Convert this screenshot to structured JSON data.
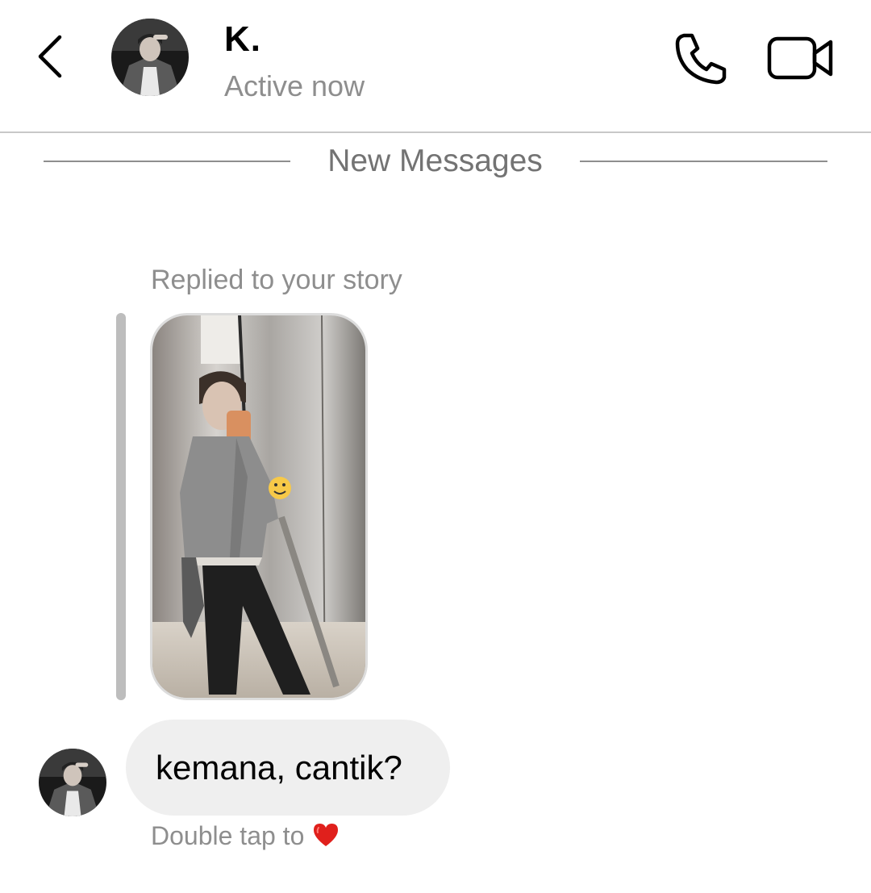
{
  "header": {
    "name": "K.",
    "status": "Active now",
    "back_icon": "chevron-left-icon",
    "call_icon": "phone-icon",
    "video_icon": "video-camera-icon"
  },
  "divider": {
    "label": "New Messages"
  },
  "story_reply": {
    "caption": "Replied to your story"
  },
  "message": {
    "text": "kemana, cantik?",
    "reaction_hint": "Double tap to",
    "reaction_icon": "red-heart-emoji"
  },
  "colors": {
    "secondary_text": "#8e8e8e",
    "bubble": "#efefef",
    "divider": "#8e8e8e",
    "heart": "#e0201c"
  }
}
